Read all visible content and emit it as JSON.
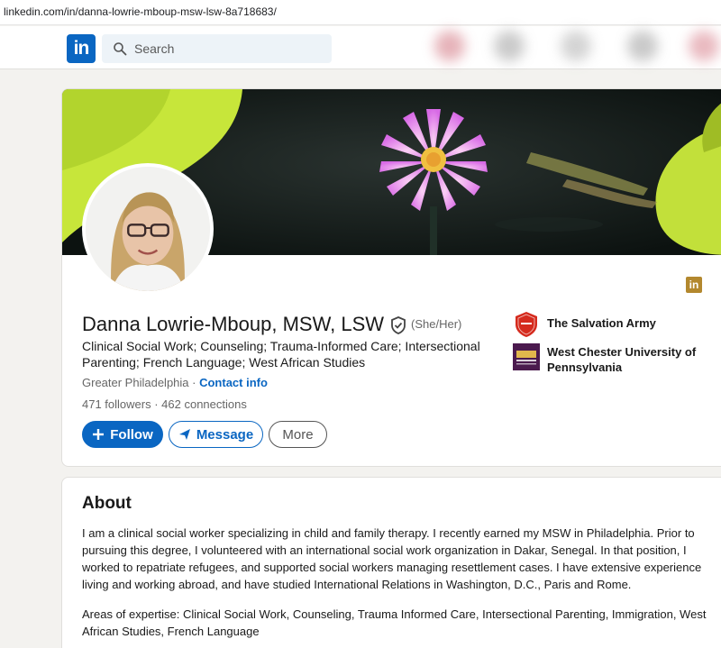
{
  "browser": {
    "url": "linkedin.com/in/danna-lowrie-mboup-msw-lsw-8a718683/"
  },
  "nav": {
    "logo_text": "in",
    "search_placeholder": "Search",
    "search_icon": "search-icon"
  },
  "profile": {
    "name": "Danna Lowrie-Mboup, MSW, LSW",
    "pronouns": "(She/Her)",
    "headline": "Clinical Social Work; Counseling; Trauma-Informed Care; Intersectional Parenting; French Language; West African Studies",
    "location": "Greater Philadelphia",
    "location_separator": " · ",
    "contact_info": "Contact info",
    "followers": "471 followers",
    "connections_separator": " · ",
    "connections": "462 connections",
    "badge_text": "in",
    "buttons": {
      "follow": "Follow",
      "message": "Message",
      "more": "More"
    },
    "organizations": [
      {
        "name": "The Salvation Army",
        "icon": "salvation-army-logo"
      },
      {
        "name": "West Chester University of Pennsylvania",
        "icon": "wcu-logo"
      }
    ]
  },
  "about": {
    "title": "About",
    "paragraph1": "I am a clinical social worker specializing in child and family therapy. I recently earned my MSW in Philadelphia. Prior to pursuing this degree, I volunteered with an international social work organization in Dakar, Senegal. In that position, I worked to repatriate refugees, and supported social workers managing resettlement cases. I have extensive experience living and working abroad, and have studied International Relations in Washington, D.C., Paris and Rome.",
    "paragraph2": "Areas of expertise: Clinical Social Work, Counseling, Trauma Informed Care, Intersectional Parenting, Immigration, West African Studies, French Language"
  },
  "colors": {
    "brand": "#0a66c2",
    "page_bg": "#f3f2ef",
    "badge": "#b3882e"
  }
}
